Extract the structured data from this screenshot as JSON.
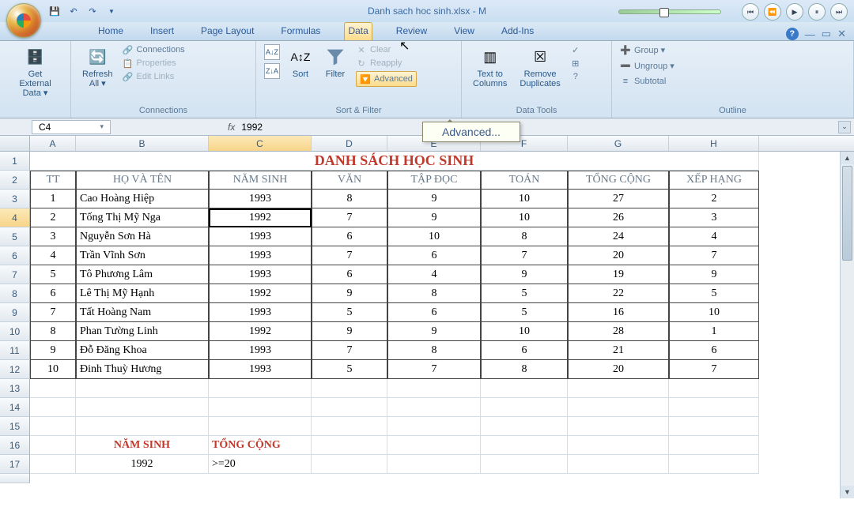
{
  "title": "Danh sach hoc sinh.xlsx - M",
  "tabs": [
    "Home",
    "Insert",
    "Page Layout",
    "Formulas",
    "Data",
    "Review",
    "View",
    "Add-Ins"
  ],
  "active_tab": 4,
  "ribbon": {
    "get_ext": "Get External\nData ▾",
    "refresh": "Refresh\nAll ▾",
    "conn": "Connections",
    "props": "Properties",
    "edit_links": "Edit Links",
    "conn_group": "Connections",
    "sort": "Sort",
    "filter": "Filter",
    "clear": "Clear",
    "reapply": "Reapply",
    "advanced": "Advanced",
    "sf_group": "Sort & Filter",
    "t2c": "Text to\nColumns",
    "remdup": "Remove\nDuplicates",
    "dt_group": "Data Tools",
    "group": "Group ▾",
    "ungroup": "Ungroup ▾",
    "subtotal": "Subtotal",
    "outline_group": "Outline"
  },
  "tooltip": "Advanced...",
  "name_box": "C4",
  "fx_label": "fx",
  "fx_value": "1992",
  "columns": [
    "A",
    "B",
    "C",
    "D",
    "E",
    "F",
    "G",
    "H"
  ],
  "table_title": "DANH SÁCH HỌC SINH",
  "headers": [
    "TT",
    "HỌ VÀ TÊN",
    "NĂM SINH",
    "VĂN",
    "TẬP ĐỌC",
    "TOÁN",
    "TỔNG CỘNG",
    "XẾP HẠNG"
  ],
  "rows": [
    {
      "tt": "1",
      "name": "Cao Hoàng Hiệp",
      "year": "1993",
      "van": "8",
      "td": "9",
      "toan": "10",
      "tong": "27",
      "xh": "2"
    },
    {
      "tt": "2",
      "name": "Tống Thị Mỹ Nga",
      "year": "1992",
      "van": "7",
      "td": "9",
      "toan": "10",
      "tong": "26",
      "xh": "3"
    },
    {
      "tt": "3",
      "name": "Nguyễn Sơn Hà",
      "year": "1993",
      "van": "6",
      "td": "10",
      "toan": "8",
      "tong": "24",
      "xh": "4"
    },
    {
      "tt": "4",
      "name": "Trần Vĩnh Sơn",
      "year": "1993",
      "van": "7",
      "td": "6",
      "toan": "7",
      "tong": "20",
      "xh": "7"
    },
    {
      "tt": "5",
      "name": "Tô Phương Lâm",
      "year": "1993",
      "van": "6",
      "td": "4",
      "toan": "9",
      "tong": "19",
      "xh": "9"
    },
    {
      "tt": "6",
      "name": "Lê Thị Mỹ Hạnh",
      "year": "1992",
      "van": "9",
      "td": "8",
      "toan": "5",
      "tong": "22",
      "xh": "5"
    },
    {
      "tt": "7",
      "name": "Tất Hoàng Nam",
      "year": "1993",
      "van": "5",
      "td": "6",
      "toan": "5",
      "tong": "16",
      "xh": "10"
    },
    {
      "tt": "8",
      "name": "Phan Tường Linh",
      "year": "1992",
      "van": "9",
      "td": "9",
      "toan": "10",
      "tong": "28",
      "xh": "1"
    },
    {
      "tt": "9",
      "name": "Đỗ Đăng Khoa",
      "year": "1993",
      "van": "7",
      "td": "8",
      "toan": "6",
      "tong": "21",
      "xh": "6"
    },
    {
      "tt": "10",
      "name": "Đinh Thuỳ Hương",
      "year": "1993",
      "van": "5",
      "td": "7",
      "toan": "8",
      "tong": "20",
      "xh": "7"
    }
  ],
  "criteria": {
    "h1": "NĂM SINH",
    "h2": "TỔNG CỘNG",
    "v1": "1992",
    "v2": ">=20"
  },
  "active_cell": {
    "row": 4,
    "col": "C"
  }
}
